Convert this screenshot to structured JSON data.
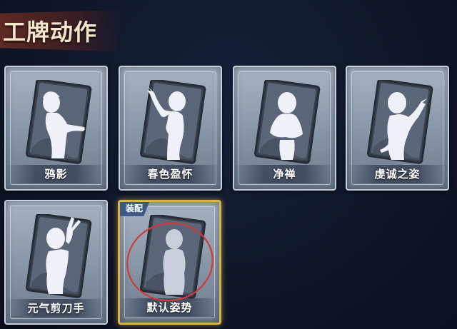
{
  "page": {
    "title": "工牌动作"
  },
  "cards": [
    {
      "label": "鸦影",
      "pose": "crow-shadow"
    },
    {
      "label": "春色盈怀",
      "pose": "spring-embrace"
    },
    {
      "label": "净禅",
      "pose": "pure-zen"
    },
    {
      "label": "虔诚之姿",
      "pose": "devout-pose"
    },
    {
      "label": "元气剪刀手",
      "pose": "peace-sign"
    },
    {
      "label": "默认姿势",
      "pose": "default",
      "badge": "装配",
      "selected": true
    }
  ],
  "colors": {
    "background": "#0f1525",
    "title": "#f3e6cc",
    "banner": "#6e2d23",
    "card": "#8c9aab",
    "selected_border": "#d9b24c",
    "badge": "#3b5a8a",
    "highlight_circle": "#d23a3a"
  }
}
